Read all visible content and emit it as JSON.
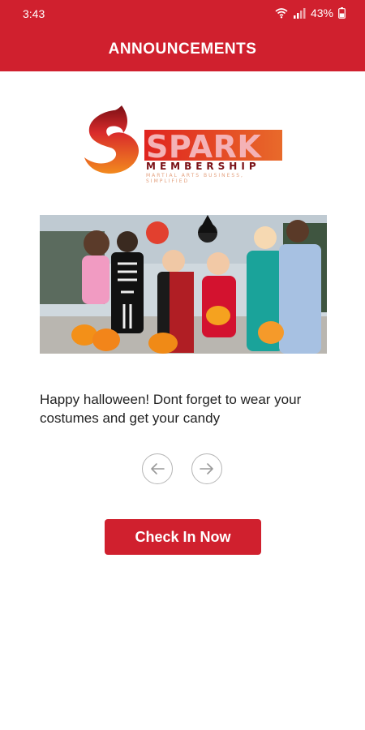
{
  "status_bar": {
    "time": "3:43",
    "battery": "43%"
  },
  "header": {
    "title": "ANNOUNCEMENTS"
  },
  "logo": {
    "word": "SPARK",
    "sub": "MEMBERSHIP",
    "tagline": "MARTIAL ARTS BUSINESS, SIMPLIFIED"
  },
  "announcement": {
    "image_alt": "Children in Halloween costumes",
    "message": "Happy halloween! Dont forget to wear your costumes and get your candy"
  },
  "actions": {
    "check_in": "Check In Now"
  },
  "colors": {
    "brand_red": "#d0202e"
  }
}
